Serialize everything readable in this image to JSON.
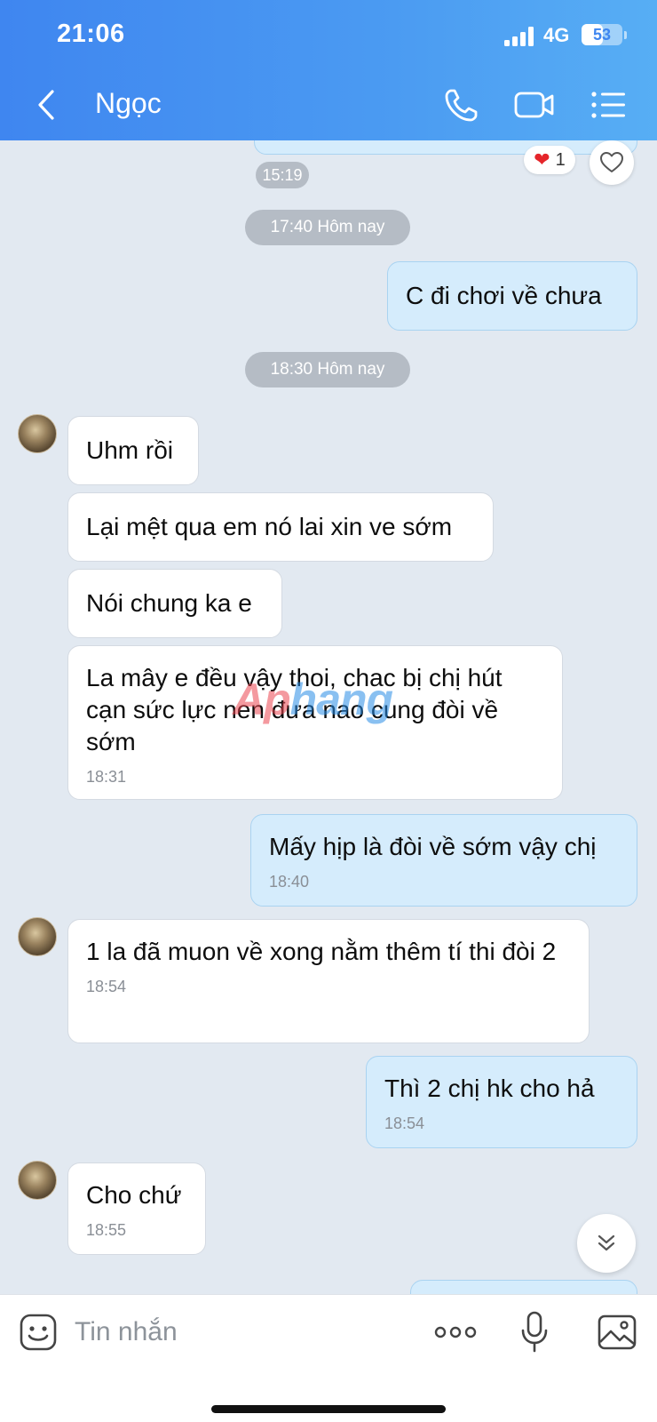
{
  "status_bar": {
    "time": "21:06",
    "network": "4G",
    "battery": "53",
    "battery_level": 0.53
  },
  "header": {
    "contact_name": "Ngọc"
  },
  "messages": {
    "top_time": "15:19",
    "reaction_count": "1",
    "divider_1": "17:40 Hôm nay",
    "out_1": "C đi chơi về chưa",
    "divider_2": "18:30 Hôm nay",
    "in_1": "Uhm rồi",
    "in_2": "Lại mệt qua em nó lai xin ve sớm",
    "in_3": "Nói chung ka e",
    "in_4": "La mây e đều vậy thoi, chac bị chị hút cạn sức lực nen đưa nao cung đòi về sớm",
    "in_4_time": "18:31",
    "out_2": "Mấy hịp là đòi về sớm vậy chị",
    "out_2_time": "18:40",
    "in_5": "1 la đã muon về xong nằm thêm tí thi đòi 2",
    "in_5_time": "18:54",
    "out_3": "Thì 2 chị hk cho hả",
    "out_3_time": "18:54",
    "in_6": "Cho chứ",
    "in_6_time": "18:55"
  },
  "watermark": {
    "part_a": "Ap",
    "part_b": "hang"
  },
  "input_bar": {
    "placeholder": "Tin nhắn"
  },
  "icons": {
    "back": "chevron-left-icon",
    "call": "phone-icon",
    "video": "video-camera-icon",
    "menu": "list-menu-icon",
    "heart": "heart-icon",
    "scroll": "chevron-double-down-icon",
    "emoji": "emoji-icon",
    "more": "more-dots-icon",
    "mic": "microphone-icon",
    "gallery": "image-gallery-icon"
  },
  "colors": {
    "header_start": "#3f86f0",
    "header_end": "#57aef4",
    "chat_bg": "#e2e9f1",
    "out_bubble": "#d5ecfc",
    "in_bubble": "#ffffff"
  }
}
